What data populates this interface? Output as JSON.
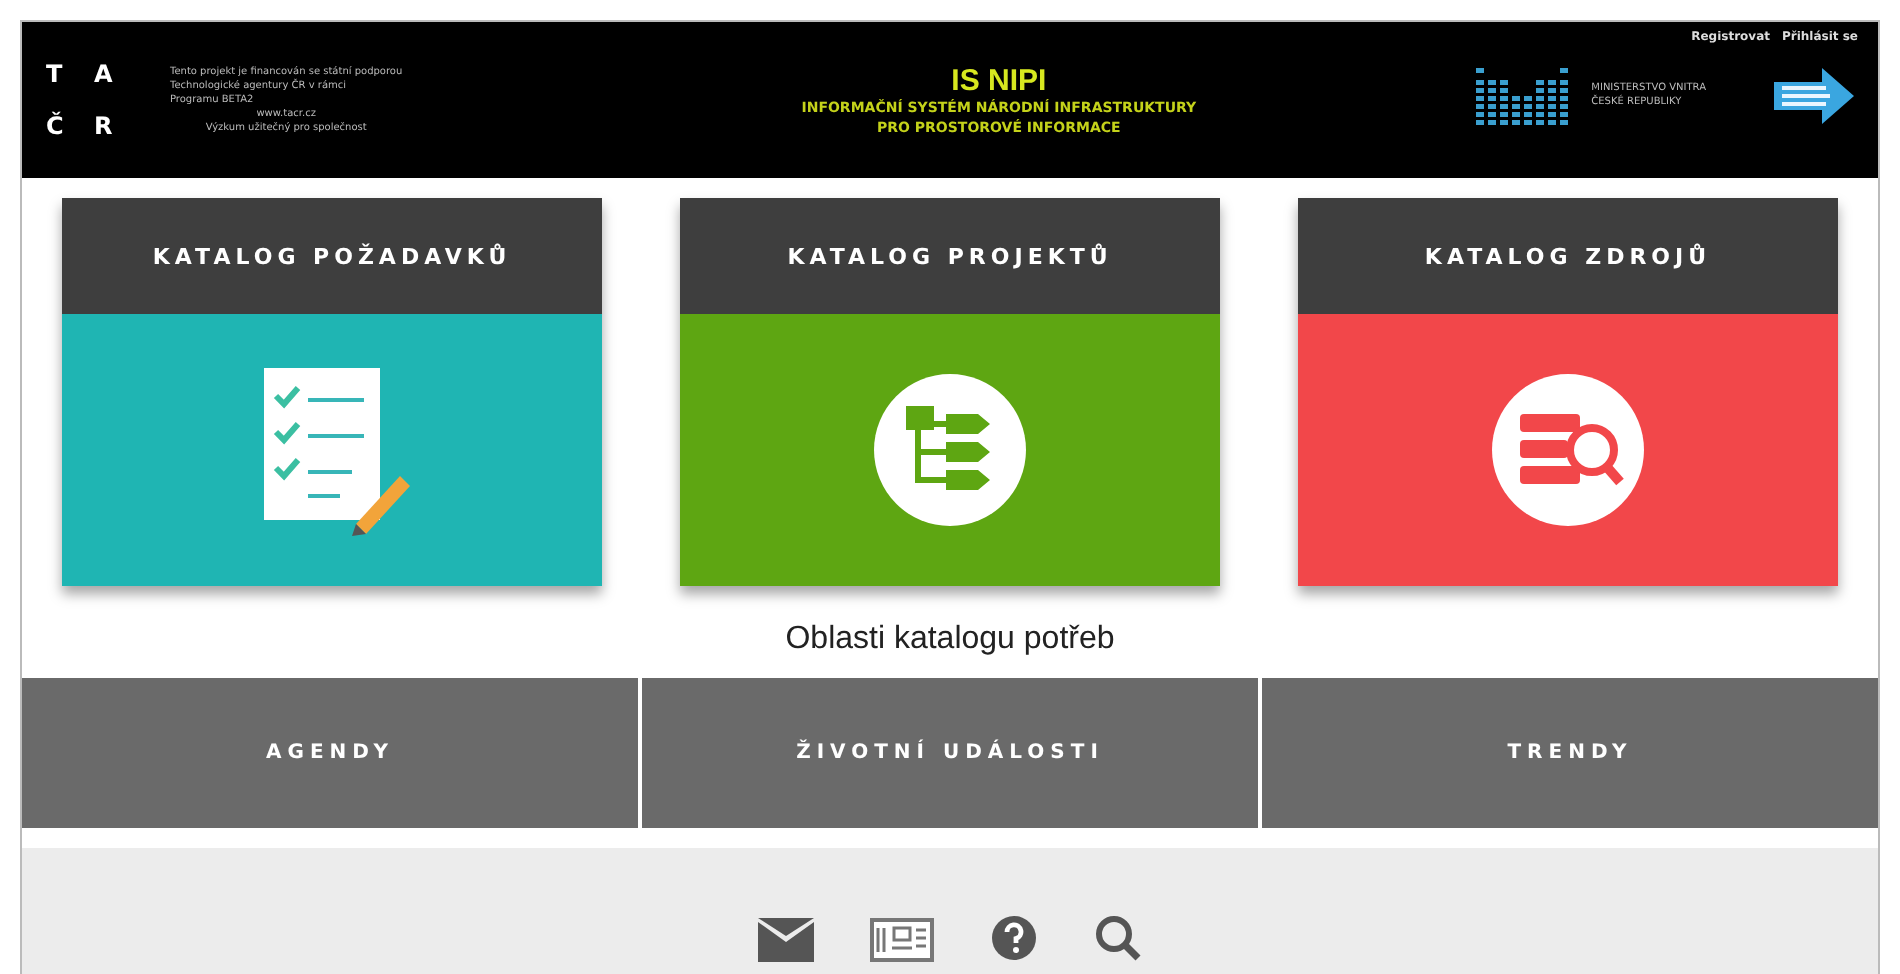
{
  "header": {
    "logo_letters": [
      "T",
      "A",
      "Č",
      "R"
    ],
    "funding_lines": [
      "Tento projekt je financován se státní podporou",
      "Technologické agentury ČR v rámci",
      "Programu BETA2"
    ],
    "funding_footer": [
      "www.tacr.cz",
      "Výzkum užitečný pro společnost"
    ],
    "title": "IS NIPI",
    "subtitle_lines": [
      "INFORMAČNÍ SYSTÉM NÁRODNÍ INFRASTRUKTURY",
      "PRO PROSTOROVÉ INFORMACE"
    ],
    "user_links": [
      "Registrovat",
      "Přihlásit se"
    ],
    "ministry_lines": [
      "MINISTERSTVO VNITRA",
      "ČESKÉ REPUBLIKY"
    ]
  },
  "catalogs": [
    {
      "title": "KATALOG POŽADAVKŮ",
      "kind": "checklist",
      "color": "#1fb5b3"
    },
    {
      "title": "KATALOG PROJEKTŮ",
      "kind": "tree",
      "color": "#5ea612"
    },
    {
      "title": "KATALOG ZDROJŮ",
      "kind": "search",
      "color": "#f2474a"
    }
  ],
  "section_title": "Oblasti katalogu potřeb",
  "areas": [
    "AGENDY",
    "ŽIVOTNÍ UDÁLOSTI",
    "TRENDY"
  ],
  "footer_icons": [
    {
      "kind": "mail"
    },
    {
      "kind": "card"
    },
    {
      "kind": "help"
    },
    {
      "kind": "search"
    }
  ]
}
